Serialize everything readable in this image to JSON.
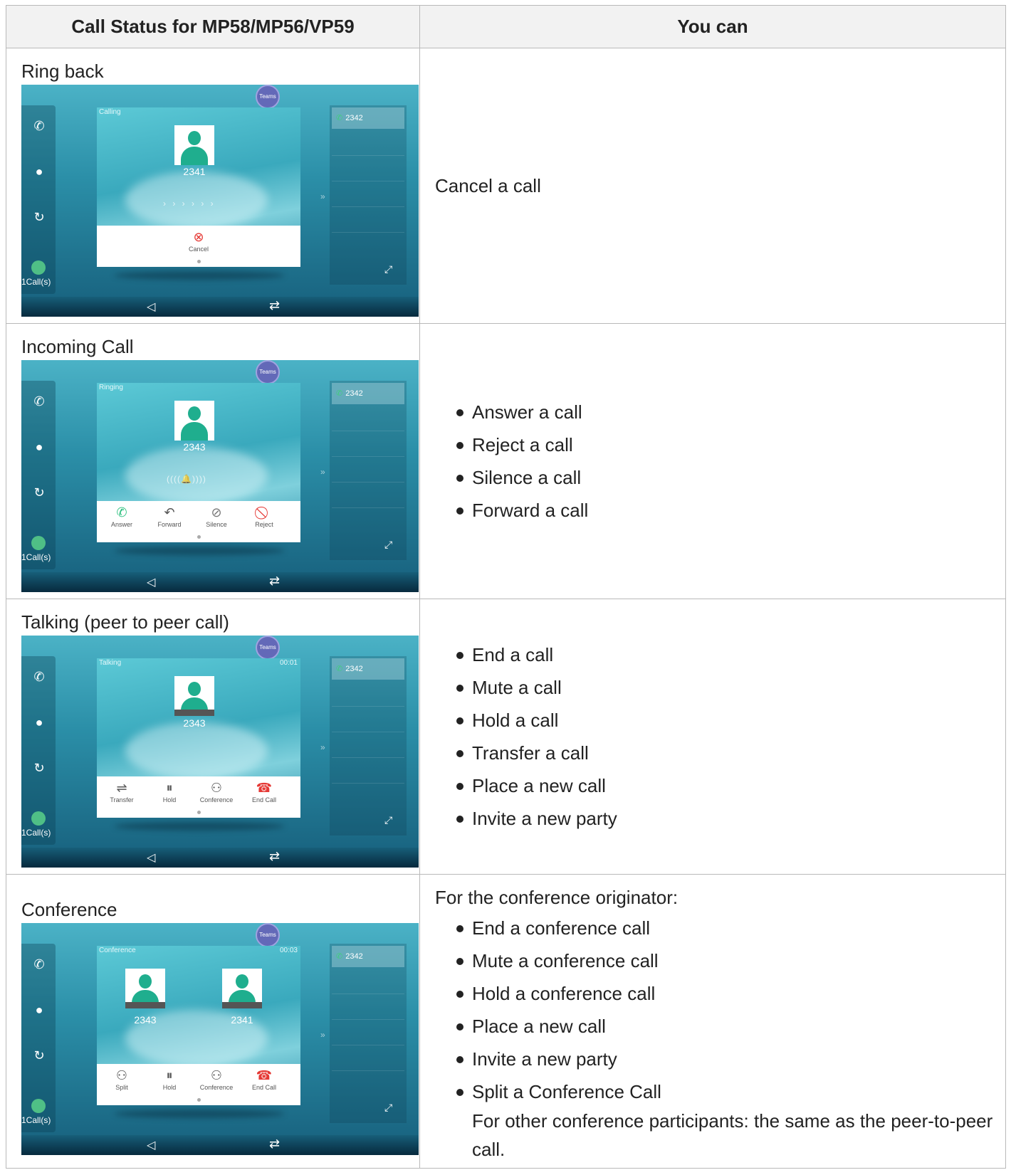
{
  "table": {
    "header_status": "Call Status for MP58/MP56/VP59",
    "header_actions": "You can"
  },
  "rows": [
    {
      "status": "Ring back",
      "screen": {
        "state_label": "Calling",
        "teams_label": "Teams",
        "numbers": [
          "2341"
        ],
        "buttons": [
          "Cancel"
        ],
        "calls_label": "1Call(s)",
        "line_entry": "2342"
      },
      "actions_text": "Cancel a call"
    },
    {
      "status": "Incoming Call",
      "screen": {
        "state_label": "Ringing",
        "teams_label": "Teams",
        "numbers": [
          "2343"
        ],
        "buttons": [
          "Answer",
          "Forward",
          "Silence",
          "Reject"
        ],
        "calls_label": "1Call(s)",
        "line_entry": "2342"
      },
      "actions": [
        "Answer a call",
        "Reject a call",
        "Silence a call",
        "Forward a call"
      ]
    },
    {
      "status": "Talking (peer to peer call)",
      "screen": {
        "state_label": "Talking",
        "timer": "00:01",
        "teams_label": "Teams",
        "numbers": [
          "2343"
        ],
        "buttons": [
          "Transfer",
          "Hold",
          "Conference",
          "End Call"
        ],
        "calls_label": "1Call(s)",
        "line_entry": "2342"
      },
      "actions": [
        "End a call",
        "Mute a call",
        "Hold a call",
        "Transfer a call",
        "Place a new call",
        "Invite a new party"
      ]
    },
    {
      "status": "Conference",
      "screen": {
        "state_label": "Conference",
        "timer": "00:03",
        "teams_label": "Teams",
        "numbers": [
          "2343",
          "2341"
        ],
        "buttons": [
          "Split",
          "Hold",
          "Conference",
          "End Call"
        ],
        "calls_label": "1Call(s)",
        "line_entry": "2342"
      },
      "actions_intro": "For the conference originator:",
      "actions": [
        "End a conference call",
        "Mute a conference call",
        "Hold a conference call",
        "Place a new call",
        "Invite a new party",
        "Split a Conference Call"
      ],
      "actions_note": "For other conference participants: the same as the peer-to-peer call."
    }
  ],
  "colors": {
    "cancel_red": "#e53935",
    "answer_green": "#2bbf7e",
    "avatar_green": "#1fae8e",
    "teams_purple": "#6369b8"
  }
}
